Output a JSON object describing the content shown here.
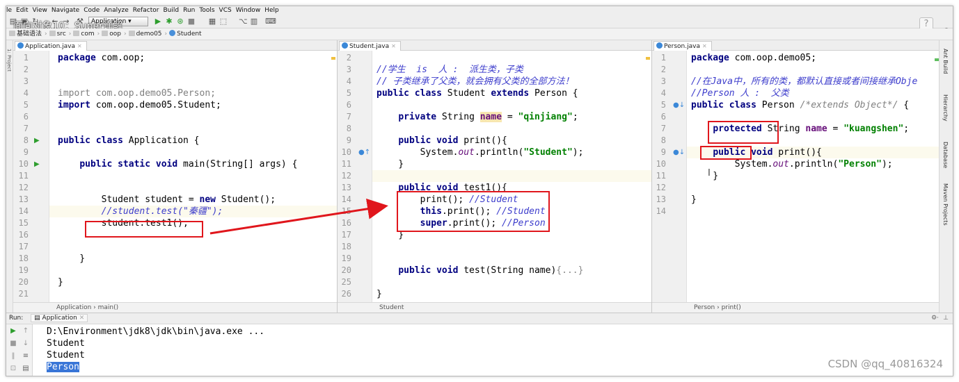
{
  "menu": [
    "le",
    "Edit",
    "View",
    "Navigate",
    "Code",
    "Analyze",
    "Refactor",
    "Build",
    "Run",
    "Tools",
    "VCS",
    "Window",
    "Help"
  ],
  "video_title": "面向对象10：Super详解",
  "toolbar": {
    "run_config": "Application",
    "help": "?"
  },
  "breadcrumbs": [
    "基础语法",
    "src",
    "com",
    "oop",
    "demo05",
    "Student"
  ],
  "left_strip_label": "1: Project",
  "right_strip": [
    "Ant Build",
    "Hierarchy",
    "Database",
    "Maven Projects"
  ],
  "editors": [
    {
      "tab": "Application.java",
      "status": [
        "Application",
        "main()"
      ],
      "lines": [
        {
          "n": "1",
          "html": "<span class='kw'>package</span> com.oop;"
        },
        {
          "n": "2",
          "html": ""
        },
        {
          "n": "3",
          "html": ""
        },
        {
          "n": "4",
          "html": "<span class='dim'>import com.oop.demo05.Person;</span>"
        },
        {
          "n": "5",
          "html": "<span class='kw'>import</span> com.oop.demo05.Student;"
        },
        {
          "n": "6",
          "html": ""
        },
        {
          "n": "7",
          "html": ""
        },
        {
          "n": "8",
          "html": "<span class='kw'>public class</span> Application {"
        },
        {
          "n": "9",
          "html": ""
        },
        {
          "n": "10",
          "html": "    <span class='kw'>public static void</span> main(String[] args) {"
        },
        {
          "n": "11",
          "html": ""
        },
        {
          "n": "12",
          "html": ""
        },
        {
          "n": "13",
          "html": "        Student student = <span class='kw'>new</span> Student();"
        },
        {
          "n": "14",
          "html": "        <span class='cmt-b'>//student.test(\"秦疆\");</span>"
        },
        {
          "n": "15",
          "html": "        student.test1();"
        },
        {
          "n": "16",
          "html": ""
        },
        {
          "n": "17",
          "html": ""
        },
        {
          "n": "18",
          "html": "    }"
        },
        {
          "n": "19",
          "html": ""
        },
        {
          "n": "20",
          "html": "}"
        },
        {
          "n": "21",
          "html": ""
        }
      ]
    },
    {
      "tab": "Student.java",
      "status": [
        "Student"
      ],
      "lines": [
        {
          "n": "2",
          "html": ""
        },
        {
          "n": "3",
          "html": "<span class='cmt-b'>//学生  is  人 :  派生类，子类</span>"
        },
        {
          "n": "4",
          "html": "<span class='cmt-b'>// 子类继承了父类，就会拥有父类的全部方法！</span>"
        },
        {
          "n": "5",
          "html": "<span class='kw'>public class</span> Student <span class='kw'>extends</span> Person {"
        },
        {
          "n": "6",
          "html": ""
        },
        {
          "n": "7",
          "html": "    <span class='kw'>private</span> String <span class='hl-field'>name</span> = <span class='str'>\"qinjiang\"</span>;"
        },
        {
          "n": "8",
          "html": ""
        },
        {
          "n": "9",
          "html": "    <span class='kw'>public void</span> print(){"
        },
        {
          "n": "10",
          "html": "        System.<span class='ital'>out</span>.println(<span class='str'>\"Student\"</span>);"
        },
        {
          "n": "11",
          "html": "    }"
        },
        {
          "n": "12",
          "html": ""
        },
        {
          "n": "13",
          "html": "    <span class='kw'>public void</span> test1(){"
        },
        {
          "n": "14",
          "html": "        print(); <span class='cmt-b'>//Student</span>"
        },
        {
          "n": "15",
          "html": "        <span class='kw'>this</span>.print(); <span class='cmt-b'>//Student</span>"
        },
        {
          "n": "16",
          "html": "        <span class='kw'>super</span>.print(); <span class='cmt-b'>//Person</span>"
        },
        {
          "n": "17",
          "html": "    }"
        },
        {
          "n": "18",
          "html": ""
        },
        {
          "n": "19",
          "html": ""
        },
        {
          "n": "20",
          "html": "    <span class='kw'>public void</span> test(String name)<span class='fold'>{...}</span>"
        },
        {
          "n": "25",
          "html": ""
        },
        {
          "n": "26",
          "html": "}"
        }
      ]
    },
    {
      "tab": "Person.java",
      "status": [
        "Person",
        "print()"
      ],
      "lines": [
        {
          "n": "1",
          "html": "<span class='kw'>package</span> com.oop.demo05;"
        },
        {
          "n": "2",
          "html": ""
        },
        {
          "n": "3",
          "html": "<span class='cmt-b'>//在Java中，所有的类，都默认直接或者间接继承Obje</span>"
        },
        {
          "n": "4",
          "html": "<span class='cmt-b'>//Person 人 :  父类</span>"
        },
        {
          "n": "5",
          "html": "<span class='kw'>public class</span> Person <span class='cmt'>/*extends Object*/</span> {"
        },
        {
          "n": "6",
          "html": ""
        },
        {
          "n": "7",
          "html": "    <span class='kw'>protected</span> String <span class='field'>name</span> = <span class='str'>\"kuangshen\"</span>;"
        },
        {
          "n": "8",
          "html": ""
        },
        {
          "n": "9",
          "html": "    <span class='kw'>public void</span> print(){"
        },
        {
          "n": "10",
          "html": "        System.<span class='ital'>out</span>.println(<span class='str'>\"Person\"</span>);"
        },
        {
          "n": "11",
          "html": "    }"
        },
        {
          "n": "12",
          "html": ""
        },
        {
          "n": "13",
          "html": "}"
        },
        {
          "n": "14",
          "html": ""
        }
      ]
    }
  ],
  "run": {
    "label": "Run:",
    "tab": "Application",
    "output": [
      "D:\\Environment\\jdk8\\jdk\\bin\\java.exe ...",
      "Student",
      "Student",
      "Person"
    ]
  },
  "watermark": "CSDN @qq_40816324",
  "colors": {
    "annotation": "#e0161c",
    "keyword": "#000080",
    "string": "#008000",
    "selection": "#3875d7"
  }
}
